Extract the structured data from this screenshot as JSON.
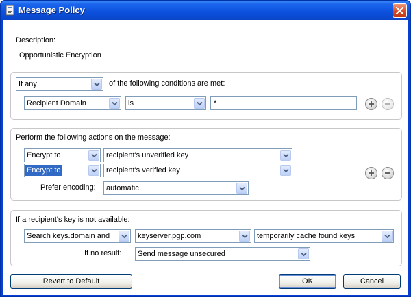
{
  "window": {
    "title": "Message Policy",
    "icon": "policy-icon",
    "close_icon": "close-icon",
    "accent": "#0a46c8",
    "close_color": "#d84a22"
  },
  "description": {
    "label": "Description:",
    "value": "Opportunistic Encryption"
  },
  "conditions": {
    "match_selected": "If any",
    "suffix": "of the following conditions are met:",
    "rows": [
      {
        "field": "Recipient Domain",
        "operator": "is",
        "value": "*"
      }
    ]
  },
  "actions": {
    "heading": "Perform the following actions on the message:",
    "rows": [
      {
        "action": "Encrypt to",
        "target": "recipient's unverified key"
      },
      {
        "action": "Encrypt to",
        "target": "recipient's verified key"
      }
    ],
    "encoding_label": "Prefer encoding:",
    "encoding_value": "automatic"
  },
  "key_unavailable": {
    "heading": "If a recipient's key is not available:",
    "method": "Search keys.domain and",
    "server": "keyserver.pgp.com",
    "cache": "temporarily cache found keys",
    "no_result_label": "If no result:",
    "no_result_value": "Send message unsecured"
  },
  "buttons": {
    "revert": "Revert to Default",
    "ok": "OK",
    "cancel": "Cancel"
  }
}
